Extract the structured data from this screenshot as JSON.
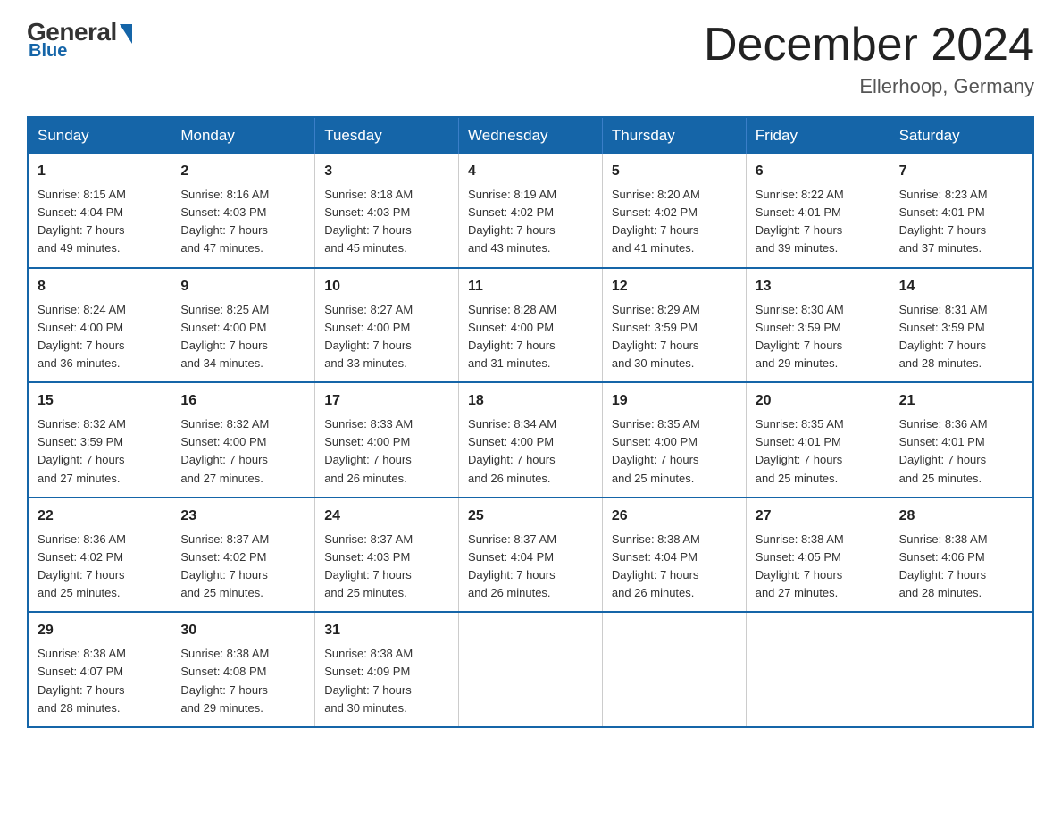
{
  "logo": {
    "general": "General",
    "blue": "Blue"
  },
  "header": {
    "title": "December 2024",
    "subtitle": "Ellerhoop, Germany"
  },
  "weekdays": [
    "Sunday",
    "Monday",
    "Tuesday",
    "Wednesday",
    "Thursday",
    "Friday",
    "Saturday"
  ],
  "weeks": [
    [
      {
        "day": "1",
        "info": "Sunrise: 8:15 AM\nSunset: 4:04 PM\nDaylight: 7 hours\nand 49 minutes."
      },
      {
        "day": "2",
        "info": "Sunrise: 8:16 AM\nSunset: 4:03 PM\nDaylight: 7 hours\nand 47 minutes."
      },
      {
        "day": "3",
        "info": "Sunrise: 8:18 AM\nSunset: 4:03 PM\nDaylight: 7 hours\nand 45 minutes."
      },
      {
        "day": "4",
        "info": "Sunrise: 8:19 AM\nSunset: 4:02 PM\nDaylight: 7 hours\nand 43 minutes."
      },
      {
        "day": "5",
        "info": "Sunrise: 8:20 AM\nSunset: 4:02 PM\nDaylight: 7 hours\nand 41 minutes."
      },
      {
        "day": "6",
        "info": "Sunrise: 8:22 AM\nSunset: 4:01 PM\nDaylight: 7 hours\nand 39 minutes."
      },
      {
        "day": "7",
        "info": "Sunrise: 8:23 AM\nSunset: 4:01 PM\nDaylight: 7 hours\nand 37 minutes."
      }
    ],
    [
      {
        "day": "8",
        "info": "Sunrise: 8:24 AM\nSunset: 4:00 PM\nDaylight: 7 hours\nand 36 minutes."
      },
      {
        "day": "9",
        "info": "Sunrise: 8:25 AM\nSunset: 4:00 PM\nDaylight: 7 hours\nand 34 minutes."
      },
      {
        "day": "10",
        "info": "Sunrise: 8:27 AM\nSunset: 4:00 PM\nDaylight: 7 hours\nand 33 minutes."
      },
      {
        "day": "11",
        "info": "Sunrise: 8:28 AM\nSunset: 4:00 PM\nDaylight: 7 hours\nand 31 minutes."
      },
      {
        "day": "12",
        "info": "Sunrise: 8:29 AM\nSunset: 3:59 PM\nDaylight: 7 hours\nand 30 minutes."
      },
      {
        "day": "13",
        "info": "Sunrise: 8:30 AM\nSunset: 3:59 PM\nDaylight: 7 hours\nand 29 minutes."
      },
      {
        "day": "14",
        "info": "Sunrise: 8:31 AM\nSunset: 3:59 PM\nDaylight: 7 hours\nand 28 minutes."
      }
    ],
    [
      {
        "day": "15",
        "info": "Sunrise: 8:32 AM\nSunset: 3:59 PM\nDaylight: 7 hours\nand 27 minutes."
      },
      {
        "day": "16",
        "info": "Sunrise: 8:32 AM\nSunset: 4:00 PM\nDaylight: 7 hours\nand 27 minutes."
      },
      {
        "day": "17",
        "info": "Sunrise: 8:33 AM\nSunset: 4:00 PM\nDaylight: 7 hours\nand 26 minutes."
      },
      {
        "day": "18",
        "info": "Sunrise: 8:34 AM\nSunset: 4:00 PM\nDaylight: 7 hours\nand 26 minutes."
      },
      {
        "day": "19",
        "info": "Sunrise: 8:35 AM\nSunset: 4:00 PM\nDaylight: 7 hours\nand 25 minutes."
      },
      {
        "day": "20",
        "info": "Sunrise: 8:35 AM\nSunset: 4:01 PM\nDaylight: 7 hours\nand 25 minutes."
      },
      {
        "day": "21",
        "info": "Sunrise: 8:36 AM\nSunset: 4:01 PM\nDaylight: 7 hours\nand 25 minutes."
      }
    ],
    [
      {
        "day": "22",
        "info": "Sunrise: 8:36 AM\nSunset: 4:02 PM\nDaylight: 7 hours\nand 25 minutes."
      },
      {
        "day": "23",
        "info": "Sunrise: 8:37 AM\nSunset: 4:02 PM\nDaylight: 7 hours\nand 25 minutes."
      },
      {
        "day": "24",
        "info": "Sunrise: 8:37 AM\nSunset: 4:03 PM\nDaylight: 7 hours\nand 25 minutes."
      },
      {
        "day": "25",
        "info": "Sunrise: 8:37 AM\nSunset: 4:04 PM\nDaylight: 7 hours\nand 26 minutes."
      },
      {
        "day": "26",
        "info": "Sunrise: 8:38 AM\nSunset: 4:04 PM\nDaylight: 7 hours\nand 26 minutes."
      },
      {
        "day": "27",
        "info": "Sunrise: 8:38 AM\nSunset: 4:05 PM\nDaylight: 7 hours\nand 27 minutes."
      },
      {
        "day": "28",
        "info": "Sunrise: 8:38 AM\nSunset: 4:06 PM\nDaylight: 7 hours\nand 28 minutes."
      }
    ],
    [
      {
        "day": "29",
        "info": "Sunrise: 8:38 AM\nSunset: 4:07 PM\nDaylight: 7 hours\nand 28 minutes."
      },
      {
        "day": "30",
        "info": "Sunrise: 8:38 AM\nSunset: 4:08 PM\nDaylight: 7 hours\nand 29 minutes."
      },
      {
        "day": "31",
        "info": "Sunrise: 8:38 AM\nSunset: 4:09 PM\nDaylight: 7 hours\nand 30 minutes."
      },
      null,
      null,
      null,
      null
    ]
  ]
}
